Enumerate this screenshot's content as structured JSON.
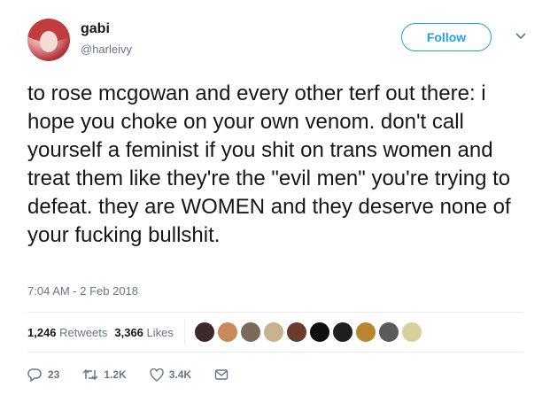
{
  "user": {
    "name": "gabi",
    "handle": "@harleivy",
    "follow_label": "Follow"
  },
  "tweet": {
    "text": "to rose mcgowan and every other terf out there: i hope you choke on your own venom. don't call yourself a feminist if you shit on trans women and treat them like they're the \"evil men\" you're trying to defeat. they are WOMEN and they deserve none of your fucking bullshit.",
    "timestamp": "7:04 AM - 2 Feb 2018"
  },
  "stats": {
    "retweets_count": "1,246",
    "retweets_label": "Retweets",
    "likes_count": "3,366",
    "likes_label": "Likes"
  },
  "likers": {
    "colors": [
      "#3a2a2a",
      "#c98a5a",
      "#7a6a5a",
      "#c9b28f",
      "#6b3b2b",
      "#0f0f0f",
      "#1e1e1e",
      "#b9862f",
      "#5b5b5b",
      "#d8cf9c"
    ]
  },
  "actions": {
    "reply_count": "23",
    "retweet_count": "1.2K",
    "like_count": "3.4K"
  },
  "icons": {
    "chevron": "chevron-down-icon",
    "reply": "reply-icon",
    "retweet": "retweet-icon",
    "like": "heart-icon",
    "message": "envelope-icon"
  }
}
